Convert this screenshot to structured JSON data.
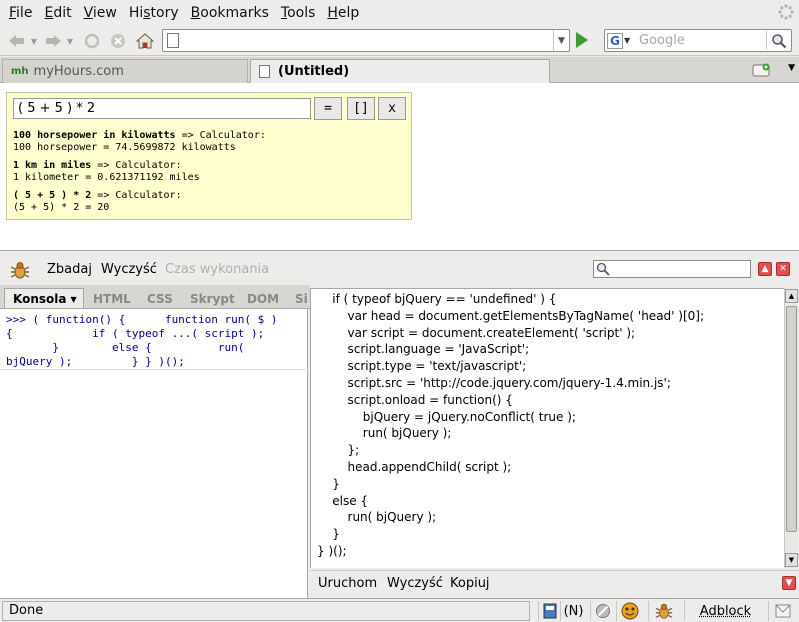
{
  "menubar": {
    "items": [
      {
        "key": "F",
        "rest": "ile"
      },
      {
        "key": "E",
        "rest": "dit"
      },
      {
        "key": "V",
        "rest": "iew"
      },
      {
        "pre": "Hi",
        "key": "s",
        "rest": "tory"
      },
      {
        "key": "B",
        "rest": "ookmarks"
      },
      {
        "key": "T",
        "rest": "ools"
      },
      {
        "key": "H",
        "rest": "elp"
      }
    ]
  },
  "navbar": {
    "url_value": "",
    "search_placeholder": "Google"
  },
  "tabs": [
    {
      "favicon_text": "mh",
      "label": "myHours.com",
      "active": false
    },
    {
      "label": "(Untitled)",
      "active": true
    }
  ],
  "calculator": {
    "input_value": "( 5 + 5 ) * 2",
    "buttons": {
      "equals": "=",
      "brackets": "[]",
      "close": "x"
    },
    "results": [
      {
        "query": "100 horsepower in kilowatts",
        "arrow": " => Calculator:",
        "answer": "100 horsepower = 74.5699872 kilowatts"
      },
      {
        "query": "1 km in miles",
        "arrow": " => Calculator:",
        "answer": "1 kilometer = 0.621371192 miles"
      },
      {
        "query": "( 5 + 5 ) * 2",
        "arrow": " => Calculator:",
        "answer": "(5 + 5) * 2 = 20"
      }
    ]
  },
  "firebug": {
    "toolbar": {
      "inspect": "Zbadaj",
      "clear": "Wyczyść",
      "timing": "Czas wykonania"
    },
    "panel_tabs": [
      "Konsola",
      "HTML",
      "CSS",
      "Skrypt",
      "DOM",
      "Si"
    ],
    "console_command": ">>> ( function() {      function run( $ )\n{            if ( typeof ...( script );\n       }        else {          run(\nbjQuery );         } } )();",
    "code": "\tif ( typeof bjQuery == 'undefined' ) {\n\t\tvar head = document.getElementsByTagName( 'head' )[0];\n\t\tvar script = document.createElement( 'script' );\n\t\tscript.language = 'JavaScript';\n\t\tscript.type = 'text/javascript';\n\t\tscript.src = 'http://code.jquery.com/jquery-1.4.min.js';\n\t\tscript.onload = function() {\n\t\t\tbjQuery = jQuery.noConflict( true );\n\t\t\trun( bjQuery );\n\t\t};\n\t\thead.appendChild( script );\n\t}\n\telse {\n\t\trun( bjQuery );\n\t}\n} )();",
    "actions": {
      "run": "Uruchom",
      "clear": "Wyczyść",
      "copy": "Kopiuj"
    }
  },
  "statusbar": {
    "text": "Done",
    "items": {
      "n_label": "(N)",
      "adblock": "Adblock"
    }
  },
  "colors": {
    "chrome_bg": "#edeceb",
    "calc_bg": "#ffffd0",
    "console_cmd": "#00008b",
    "go_green": "#3e9a35",
    "close_red": "#e05050"
  }
}
